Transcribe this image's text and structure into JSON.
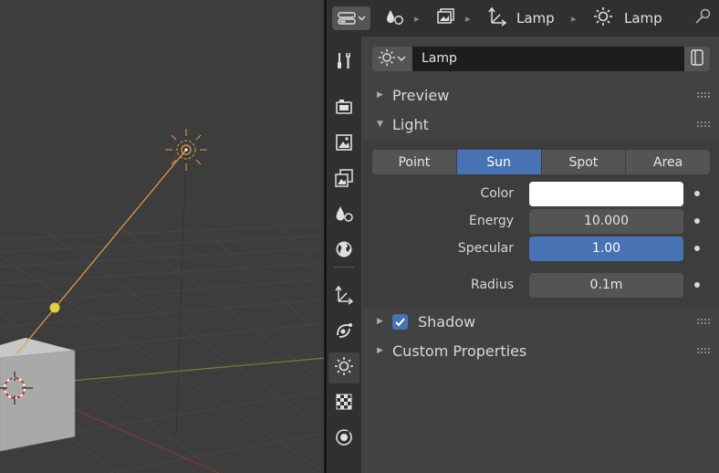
{
  "header": {
    "breadcrumb": [
      {
        "icon": "object-data-icon",
        "label": ""
      },
      {
        "icon": "scene-icon",
        "label": ""
      },
      {
        "icon": "axes-object-icon",
        "label": "Lamp"
      },
      {
        "icon": "sun-lamp-icon",
        "label": "Lamp"
      }
    ],
    "pin_icon": "pin-icon"
  },
  "tabs": [
    {
      "name": "tool",
      "icon": "wrench-screwdriver-icon"
    },
    {
      "name": "render",
      "icon": "camera-back-icon"
    },
    {
      "name": "output",
      "icon": "image-icon"
    },
    {
      "name": "view-layer",
      "icon": "image-stack-icon"
    },
    {
      "name": "scene",
      "icon": "scene-shapes-icon"
    },
    {
      "name": "world",
      "icon": "globe-icon"
    },
    {
      "name": "object",
      "icon": "axes-object-icon"
    },
    {
      "name": "constraints",
      "icon": "constraint-icon"
    },
    {
      "name": "light-data",
      "icon": "sun-lamp-icon",
      "active": true
    },
    {
      "name": "texture",
      "icon": "checkerboard-icon"
    },
    {
      "name": "particles",
      "icon": "physics-icon"
    }
  ],
  "datablock": {
    "name": "Lamp"
  },
  "panels": {
    "preview": {
      "title": "Preview",
      "expanded": false
    },
    "light": {
      "title": "Light",
      "expanded": true
    },
    "shadow": {
      "title": "Shadow",
      "expanded": false,
      "enabled": true
    },
    "custom_properties": {
      "title": "Custom Properties",
      "expanded": false
    }
  },
  "light": {
    "types": [
      "Point",
      "Sun",
      "Spot",
      "Area"
    ],
    "selected_type": "Sun",
    "color_label": "Color",
    "color_value": "#ffffff",
    "energy_label": "Energy",
    "energy_value": "10.000",
    "specular_label": "Specular",
    "specular_value": "1.00",
    "radius_label": "Radius",
    "radius_value": "0.1m"
  },
  "colors": {
    "accent": "#4772b3",
    "panel_bg": "#424242",
    "field_bg": "#545454",
    "lamp_orange": "#e8a040"
  }
}
